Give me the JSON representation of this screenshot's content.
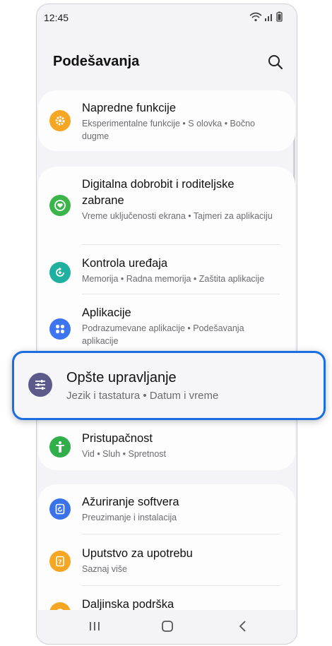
{
  "status": {
    "time": "12:45"
  },
  "header": {
    "title": "Podešavanja"
  },
  "items": [
    {
      "title": "Napredne funkcije",
      "subtitle": "Eksperimentalne funkcije  •  S olovka  •  Bočno dugme",
      "icon": "gear-icon",
      "color": "#f5a623"
    },
    {
      "title": "Digitalna dobrobit i roditeljske zabrane",
      "subtitle": "Vreme uključenosti ekrana  •  Tajmeri za aplikaciju",
      "icon": "heart-circle-icon",
      "color": "#3bb54a"
    },
    {
      "title": "Kontrola uređaja",
      "subtitle": "Memorija  •  Radna memorija  •  Zaštita aplikacije",
      "icon": "refresh-icon",
      "color": "#20b0a0"
    },
    {
      "title": "Aplikacije",
      "subtitle": "Podrazumevane aplikacije  •  Podešavanja aplikacije",
      "icon": "apps-grid-icon",
      "color": "#3d74f0"
    },
    {
      "title": "Opšte upravljanje",
      "subtitle": "Jezik i tastatura  •  Datum i vreme",
      "icon": "sliders-icon",
      "color": "#5c5a8a"
    },
    {
      "title": "Pristupačnost",
      "subtitle": "Vid  •  Sluh  •  Spretnost",
      "icon": "accessibility-icon",
      "color": "#2fae4a"
    },
    {
      "title": "Ažuriranje softvera",
      "subtitle": "Preuzimanje i instalacija",
      "icon": "update-icon",
      "color": "#3a72e8"
    },
    {
      "title": "Uputstvo za upotrebu",
      "subtitle": "Saznaj više",
      "icon": "help-book-icon",
      "color": "#f5a623"
    },
    {
      "title": "Daljinska podrška",
      "subtitle": "",
      "icon": "headset-icon",
      "color": "#f5a623"
    }
  ]
}
